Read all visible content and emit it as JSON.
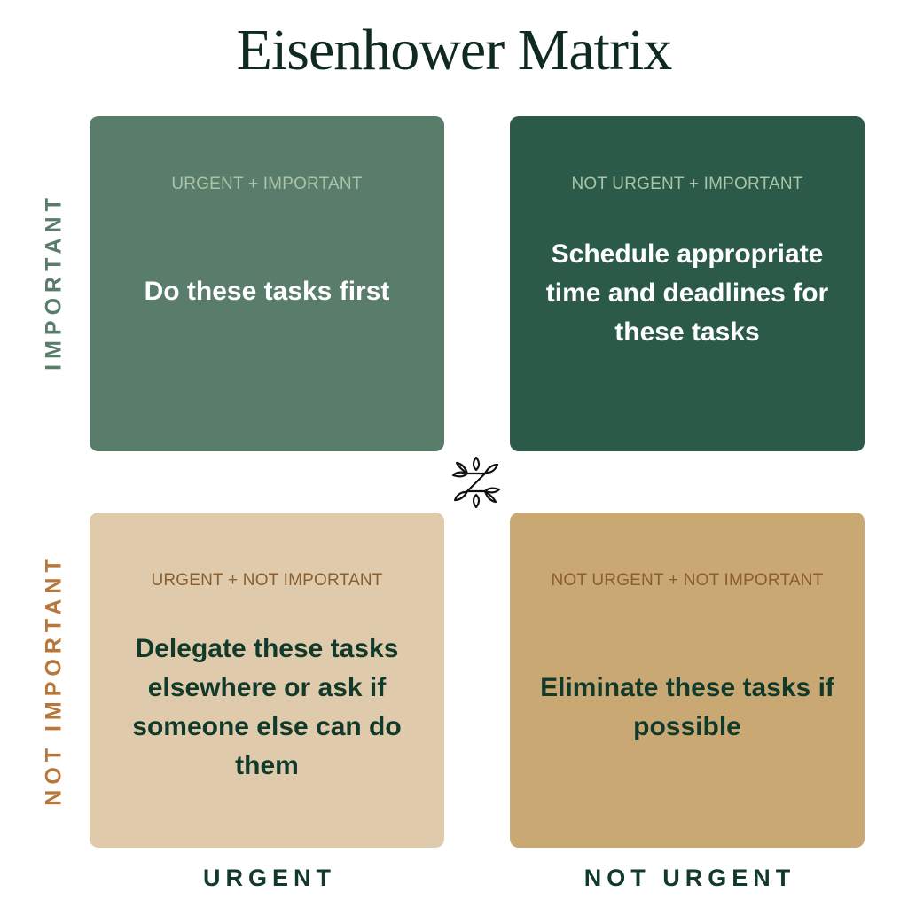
{
  "title": "Eisenhower Matrix",
  "axes": {
    "y_top": "IMPORTANT",
    "y_bottom": "NOT IMPORTANT",
    "x_left": "URGENT",
    "x_right": "NOT URGENT"
  },
  "quadrants": [
    {
      "category": "URGENT + IMPORTANT",
      "action": "Do these tasks first",
      "color": "#5a7d6b"
    },
    {
      "category": "NOT URGENT + IMPORTANT",
      "action": "Schedule appropriate time and deadlines for these tasks",
      "color": "#2b5a48"
    },
    {
      "category": "URGENT + NOT IMPORTANT",
      "action": "Delegate these tasks elsewhere or ask if someone else can do them",
      "color": "#dfcbac"
    },
    {
      "category": "NOT URGENT + NOT IMPORTANT",
      "action": "Eliminate these tasks if possible",
      "color": "#c9a874"
    }
  ],
  "logo_icon": "leaf-z-logo-icon"
}
